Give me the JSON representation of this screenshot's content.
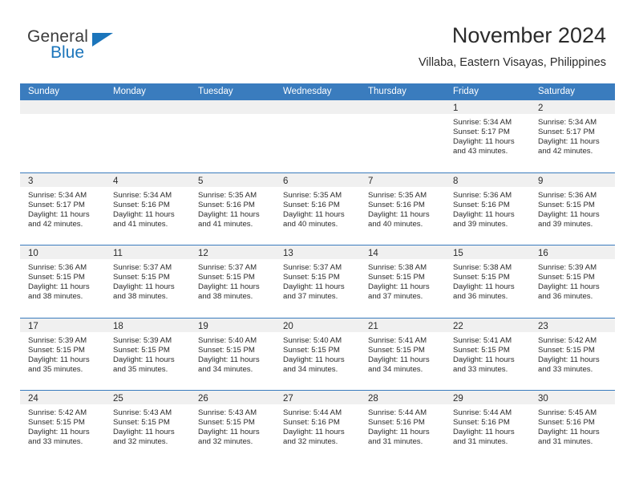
{
  "brand": {
    "name_part1": "General",
    "name_part2": "Blue",
    "accent_color": "#1b75bb"
  },
  "header": {
    "month_title": "November 2024",
    "location": "Villaba, Eastern Visayas, Philippines"
  },
  "theme": {
    "header_row_color": "#3a7cbe",
    "day_band_color": "#f0f0f0",
    "text_color": "#2b2b2b"
  },
  "calendar": {
    "weekday_headers": [
      "Sunday",
      "Monday",
      "Tuesday",
      "Wednesday",
      "Thursday",
      "Friday",
      "Saturday"
    ],
    "weeks": [
      [
        {
          "day": "",
          "sunrise": "",
          "sunset": "",
          "daylight_line1": "",
          "daylight_line2": ""
        },
        {
          "day": "",
          "sunrise": "",
          "sunset": "",
          "daylight_line1": "",
          "daylight_line2": ""
        },
        {
          "day": "",
          "sunrise": "",
          "sunset": "",
          "daylight_line1": "",
          "daylight_line2": ""
        },
        {
          "day": "",
          "sunrise": "",
          "sunset": "",
          "daylight_line1": "",
          "daylight_line2": ""
        },
        {
          "day": "",
          "sunrise": "",
          "sunset": "",
          "daylight_line1": "",
          "daylight_line2": ""
        },
        {
          "day": "1",
          "sunrise": "Sunrise: 5:34 AM",
          "sunset": "Sunset: 5:17 PM",
          "daylight_line1": "Daylight: 11 hours",
          "daylight_line2": "and 43 minutes."
        },
        {
          "day": "2",
          "sunrise": "Sunrise: 5:34 AM",
          "sunset": "Sunset: 5:17 PM",
          "daylight_line1": "Daylight: 11 hours",
          "daylight_line2": "and 42 minutes."
        }
      ],
      [
        {
          "day": "3",
          "sunrise": "Sunrise: 5:34 AM",
          "sunset": "Sunset: 5:17 PM",
          "daylight_line1": "Daylight: 11 hours",
          "daylight_line2": "and 42 minutes."
        },
        {
          "day": "4",
          "sunrise": "Sunrise: 5:34 AM",
          "sunset": "Sunset: 5:16 PM",
          "daylight_line1": "Daylight: 11 hours",
          "daylight_line2": "and 41 minutes."
        },
        {
          "day": "5",
          "sunrise": "Sunrise: 5:35 AM",
          "sunset": "Sunset: 5:16 PM",
          "daylight_line1": "Daylight: 11 hours",
          "daylight_line2": "and 41 minutes."
        },
        {
          "day": "6",
          "sunrise": "Sunrise: 5:35 AM",
          "sunset": "Sunset: 5:16 PM",
          "daylight_line1": "Daylight: 11 hours",
          "daylight_line2": "and 40 minutes."
        },
        {
          "day": "7",
          "sunrise": "Sunrise: 5:35 AM",
          "sunset": "Sunset: 5:16 PM",
          "daylight_line1": "Daylight: 11 hours",
          "daylight_line2": "and 40 minutes."
        },
        {
          "day": "8",
          "sunrise": "Sunrise: 5:36 AM",
          "sunset": "Sunset: 5:16 PM",
          "daylight_line1": "Daylight: 11 hours",
          "daylight_line2": "and 39 minutes."
        },
        {
          "day": "9",
          "sunrise": "Sunrise: 5:36 AM",
          "sunset": "Sunset: 5:15 PM",
          "daylight_line1": "Daylight: 11 hours",
          "daylight_line2": "and 39 minutes."
        }
      ],
      [
        {
          "day": "10",
          "sunrise": "Sunrise: 5:36 AM",
          "sunset": "Sunset: 5:15 PM",
          "daylight_line1": "Daylight: 11 hours",
          "daylight_line2": "and 38 minutes."
        },
        {
          "day": "11",
          "sunrise": "Sunrise: 5:37 AM",
          "sunset": "Sunset: 5:15 PM",
          "daylight_line1": "Daylight: 11 hours",
          "daylight_line2": "and 38 minutes."
        },
        {
          "day": "12",
          "sunrise": "Sunrise: 5:37 AM",
          "sunset": "Sunset: 5:15 PM",
          "daylight_line1": "Daylight: 11 hours",
          "daylight_line2": "and 38 minutes."
        },
        {
          "day": "13",
          "sunrise": "Sunrise: 5:37 AM",
          "sunset": "Sunset: 5:15 PM",
          "daylight_line1": "Daylight: 11 hours",
          "daylight_line2": "and 37 minutes."
        },
        {
          "day": "14",
          "sunrise": "Sunrise: 5:38 AM",
          "sunset": "Sunset: 5:15 PM",
          "daylight_line1": "Daylight: 11 hours",
          "daylight_line2": "and 37 minutes."
        },
        {
          "day": "15",
          "sunrise": "Sunrise: 5:38 AM",
          "sunset": "Sunset: 5:15 PM",
          "daylight_line1": "Daylight: 11 hours",
          "daylight_line2": "and 36 minutes."
        },
        {
          "day": "16",
          "sunrise": "Sunrise: 5:39 AM",
          "sunset": "Sunset: 5:15 PM",
          "daylight_line1": "Daylight: 11 hours",
          "daylight_line2": "and 36 minutes."
        }
      ],
      [
        {
          "day": "17",
          "sunrise": "Sunrise: 5:39 AM",
          "sunset": "Sunset: 5:15 PM",
          "daylight_line1": "Daylight: 11 hours",
          "daylight_line2": "and 35 minutes."
        },
        {
          "day": "18",
          "sunrise": "Sunrise: 5:39 AM",
          "sunset": "Sunset: 5:15 PM",
          "daylight_line1": "Daylight: 11 hours",
          "daylight_line2": "and 35 minutes."
        },
        {
          "day": "19",
          "sunrise": "Sunrise: 5:40 AM",
          "sunset": "Sunset: 5:15 PM",
          "daylight_line1": "Daylight: 11 hours",
          "daylight_line2": "and 34 minutes."
        },
        {
          "day": "20",
          "sunrise": "Sunrise: 5:40 AM",
          "sunset": "Sunset: 5:15 PM",
          "daylight_line1": "Daylight: 11 hours",
          "daylight_line2": "and 34 minutes."
        },
        {
          "day": "21",
          "sunrise": "Sunrise: 5:41 AM",
          "sunset": "Sunset: 5:15 PM",
          "daylight_line1": "Daylight: 11 hours",
          "daylight_line2": "and 34 minutes."
        },
        {
          "day": "22",
          "sunrise": "Sunrise: 5:41 AM",
          "sunset": "Sunset: 5:15 PM",
          "daylight_line1": "Daylight: 11 hours",
          "daylight_line2": "and 33 minutes."
        },
        {
          "day": "23",
          "sunrise": "Sunrise: 5:42 AM",
          "sunset": "Sunset: 5:15 PM",
          "daylight_line1": "Daylight: 11 hours",
          "daylight_line2": "and 33 minutes."
        }
      ],
      [
        {
          "day": "24",
          "sunrise": "Sunrise: 5:42 AM",
          "sunset": "Sunset: 5:15 PM",
          "daylight_line1": "Daylight: 11 hours",
          "daylight_line2": "and 33 minutes."
        },
        {
          "day": "25",
          "sunrise": "Sunrise: 5:43 AM",
          "sunset": "Sunset: 5:15 PM",
          "daylight_line1": "Daylight: 11 hours",
          "daylight_line2": "and 32 minutes."
        },
        {
          "day": "26",
          "sunrise": "Sunrise: 5:43 AM",
          "sunset": "Sunset: 5:15 PM",
          "daylight_line1": "Daylight: 11 hours",
          "daylight_line2": "and 32 minutes."
        },
        {
          "day": "27",
          "sunrise": "Sunrise: 5:44 AM",
          "sunset": "Sunset: 5:16 PM",
          "daylight_line1": "Daylight: 11 hours",
          "daylight_line2": "and 32 minutes."
        },
        {
          "day": "28",
          "sunrise": "Sunrise: 5:44 AM",
          "sunset": "Sunset: 5:16 PM",
          "daylight_line1": "Daylight: 11 hours",
          "daylight_line2": "and 31 minutes."
        },
        {
          "day": "29",
          "sunrise": "Sunrise: 5:44 AM",
          "sunset": "Sunset: 5:16 PM",
          "daylight_line1": "Daylight: 11 hours",
          "daylight_line2": "and 31 minutes."
        },
        {
          "day": "30",
          "sunrise": "Sunrise: 5:45 AM",
          "sunset": "Sunset: 5:16 PM",
          "daylight_line1": "Daylight: 11 hours",
          "daylight_line2": "and 31 minutes."
        }
      ]
    ]
  }
}
